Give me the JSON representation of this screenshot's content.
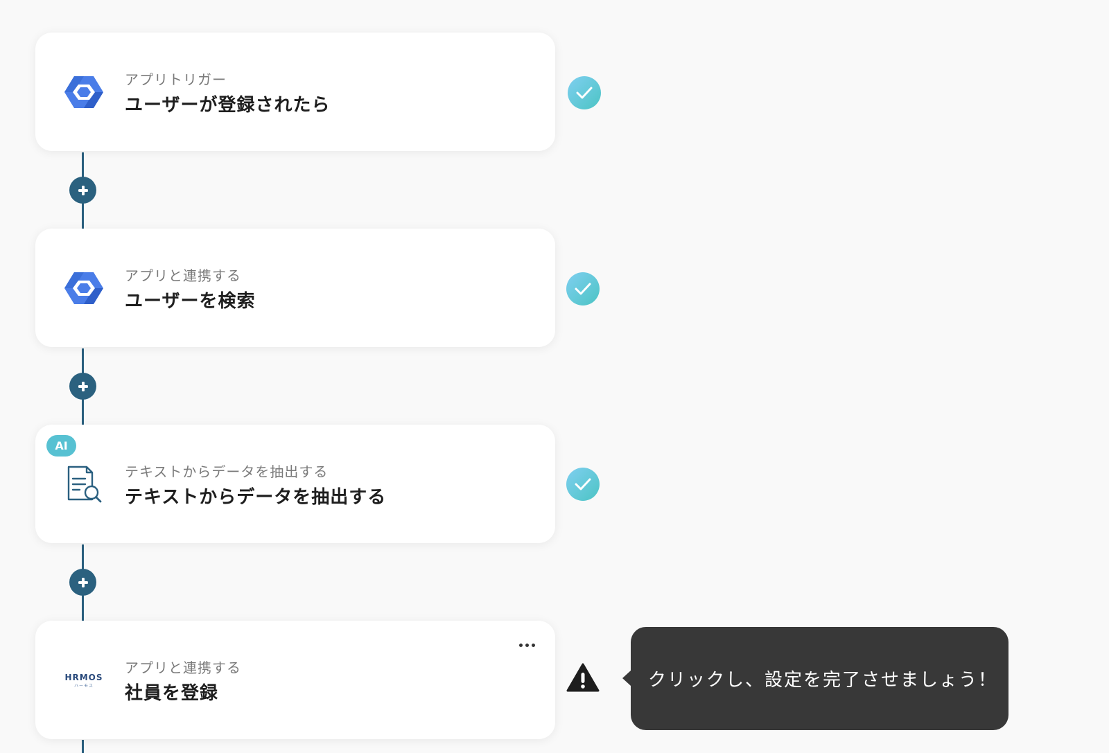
{
  "steps": [
    {
      "subtitle": "アプリトリガー",
      "title": "ユーザーが登録されたら",
      "icon": "google-workspace-admin-icon",
      "status": "complete"
    },
    {
      "subtitle": "アプリと連携する",
      "title": "ユーザーを検索",
      "icon": "google-workspace-admin-icon",
      "status": "complete"
    },
    {
      "badge": "AI",
      "subtitle": "テキストからデータを抽出する",
      "title": "テキストからデータを抽出する",
      "icon": "document-search-icon",
      "status": "complete"
    },
    {
      "subtitle": "アプリと連携する",
      "title": "社員を登録",
      "icon": "hrmos-logo",
      "logo_text": "HRMOS",
      "logo_subtext": "ハーモス",
      "status": "warning"
    }
  ],
  "tooltip": {
    "text": "クリックし、設定を完了させましょう！"
  },
  "colors": {
    "background": "#f9f9f9",
    "connector": "#2b617f",
    "check_gradient_start": "#7fcff0",
    "check_gradient_end": "#4cc4c4",
    "ai_badge": "#57c1d2",
    "tooltip_bg": "#383838",
    "google_blue": "#4a7de8"
  }
}
